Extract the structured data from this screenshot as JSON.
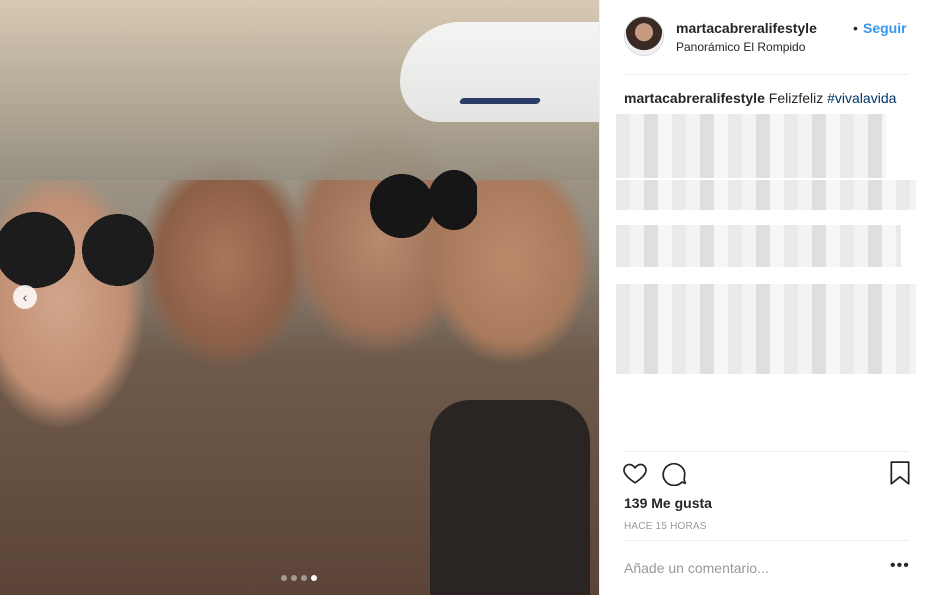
{
  "post": {
    "username": "martacabreralifestyle",
    "separator": "•",
    "follow_label": "Seguir",
    "location": "Panorámico El Rompido",
    "caption": {
      "username": "martacabreralifestyle",
      "text": "Felizfeliz",
      "hashtag": "#vivalavida"
    },
    "likes": "139 Me gusta",
    "time": "HACE 15 HORAS",
    "comment_placeholder": "Añade un comentario...",
    "more_label": "•••"
  },
  "carousel": {
    "prev_icon": "chevron-left-icon",
    "dots": 4,
    "active_index": 3
  },
  "colors": {
    "accent": "#3897f0",
    "hashtag": "#003569",
    "text": "#262626",
    "muted": "#999999",
    "divider": "#efefef"
  },
  "icons": {
    "like": "heart-icon",
    "comment": "comment-icon",
    "save": "bookmark-icon"
  }
}
